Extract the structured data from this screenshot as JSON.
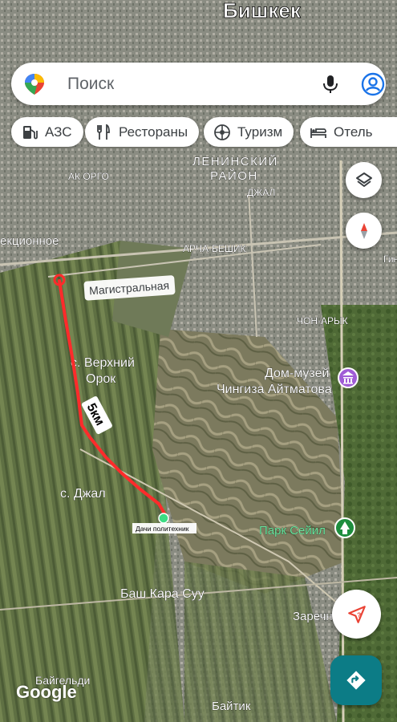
{
  "map": {
    "city_title": "Бишкек",
    "district_line1": "ЛЕНИНСКИЙ",
    "district_line2": "РАЙОН",
    "labels": {
      "ak_orgo": "АК ОРГО",
      "dzhal_n": "ДЖАЛ",
      "archa_beshik": "АРЧА-БЕШИК",
      "chon_aryk": "ЧОН-АРЫК",
      "ektsionnoe": "екционное",
      "gin": "Гин",
      "magistralnaya": "Магистральная",
      "verkhniy_orok_1": "с. Верхний",
      "verkhniy_orok_2": "Орок",
      "dzhal_village": "с. Джал",
      "dom_muzey_1": "Дом-музей",
      "dom_muzey_2": "Чингиза Айтматова",
      "park_seyil": "Парк Сейил",
      "bash_kara_suu": "Баш Кара Суу",
      "zarechnoe": "Заречн",
      "bayteldi": "Байгельди",
      "baytik": "Байтик"
    },
    "route": {
      "distance_annotation": "5км",
      "destination_label": "Дачи политехник",
      "route_color": "#ff2b2b",
      "destination_color": "#3ddc84"
    }
  },
  "search": {
    "placeholder": "Поиск",
    "logo_icon": "google-maps-pin-icon",
    "mic_icon": "mic-icon",
    "account_icon": "account-icon"
  },
  "chips": [
    {
      "label": "АЗС",
      "icon": "gas-station-icon"
    },
    {
      "label": "Рестораны",
      "icon": "restaurant-icon"
    },
    {
      "label": "Туризм",
      "icon": "attraction-icon"
    },
    {
      "label": "Отель",
      "icon": "hotel-icon"
    }
  ],
  "controls": {
    "layers_icon": "layers-icon",
    "compass_icon": "compass-icon",
    "location_icon": "my-location-icon",
    "directions_icon": "directions-icon"
  },
  "attribution": "Google",
  "colors": {
    "directions_button": "#0c7c86",
    "accent_blue": "#1a73e8"
  }
}
